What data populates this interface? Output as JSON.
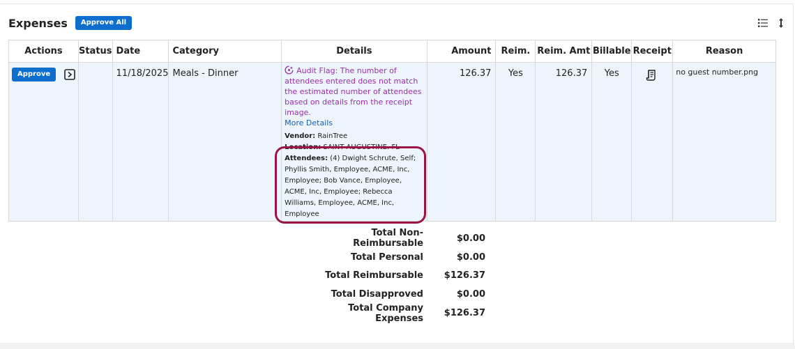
{
  "header": {
    "title": "Expenses",
    "approve_all_label": "Approve All"
  },
  "toolbar": {
    "icons": [
      "list-view-icon",
      "sort-icon"
    ]
  },
  "table": {
    "columns": [
      "Actions",
      "Status",
      "Date",
      "Category",
      "Details",
      "Amount",
      "Reim.",
      "Reim. Amt",
      "Billable",
      "Receipt",
      "Reason"
    ],
    "rows": [
      {
        "approve_label": "Approve",
        "status": "",
        "date": "11/18/2025",
        "category": "Meals - Dinner",
        "audit_flag": "Audit Flag: The number of attendees entered does not match the estimated number of attendees based on details from the receipt image.",
        "more_details": "More Details",
        "vendor_label": "Vendor:",
        "vendor": "RainTree",
        "location_label": "Location:",
        "location": "SAINT AUGUSTINE, FL",
        "attendees_label": "Attendees:",
        "attendees": "(4) Dwight Schrute, Self; Phyllis Smith, Employee, ACME, Inc, Employee; Bob Vance, Employee, ACME, Inc, Employee; Rebecca Williams, Employee, ACME, Inc, Employee",
        "amount": "126.37",
        "reimbursable": "Yes",
        "reim_amt": "126.37",
        "billable": "Yes",
        "reason": "no guest number.png"
      }
    ]
  },
  "totals": [
    {
      "label": "Total Non-Reimbursable",
      "value": "$0.00"
    },
    {
      "label": "Total Personal",
      "value": "$0.00"
    },
    {
      "label": "Total Reimbursable",
      "value": "$126.37"
    },
    {
      "label": "Total Disapproved",
      "value": "$0.00"
    },
    {
      "label": "Total Company Expenses",
      "value": "$126.37"
    }
  ],
  "colors": {
    "primary_button": "#0d6ecd",
    "audit_flag": "#9a2fa6",
    "link": "#0d62b8",
    "highlight": "#9c1446",
    "row_bg": "#edf4fc"
  }
}
